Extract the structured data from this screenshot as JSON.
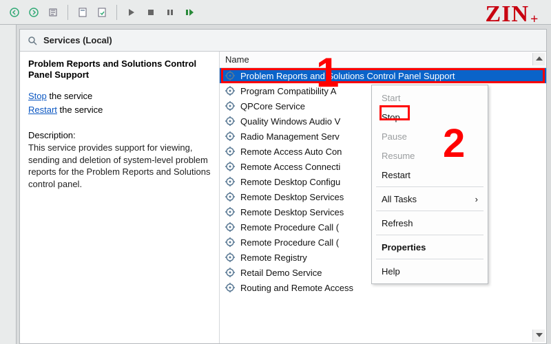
{
  "tab": {
    "title": "Services (Local)"
  },
  "detail": {
    "title": "Problem Reports and Solutions Control Panel Support",
    "stop_link": "Stop",
    "stop_suffix": " the service",
    "restart_link": "Restart",
    "restart_suffix": " the service",
    "desc_label": "Description:",
    "description": "This service provides support for viewing, sending and deletion of system-level problem reports for the Problem Reports and Solutions control panel."
  },
  "list": {
    "column": "Name",
    "services": [
      "Problem Reports and Solutions Control Panel Support",
      "Program Compatibility A",
      "QPCore Service",
      "Quality Windows Audio V",
      "Radio Management Serv",
      "Remote Access Auto Con",
      "Remote Access Connecti",
      "Remote Desktop Configu",
      "Remote Desktop Services",
      "Remote Desktop Services",
      "Remote Procedure Call (",
      "Remote Procedure Call (",
      "Remote Registry",
      "Retail Demo Service",
      "Routing and Remote Access"
    ]
  },
  "context_menu": {
    "start": "Start",
    "stop": "Stop",
    "pause": "Pause",
    "resume": "Resume",
    "restart": "Restart",
    "all_tasks": "All Tasks",
    "refresh": "Refresh",
    "properties": "Properties",
    "help": "Help"
  },
  "annotations": {
    "one": "1",
    "two": "2"
  },
  "logo": "ZIN"
}
